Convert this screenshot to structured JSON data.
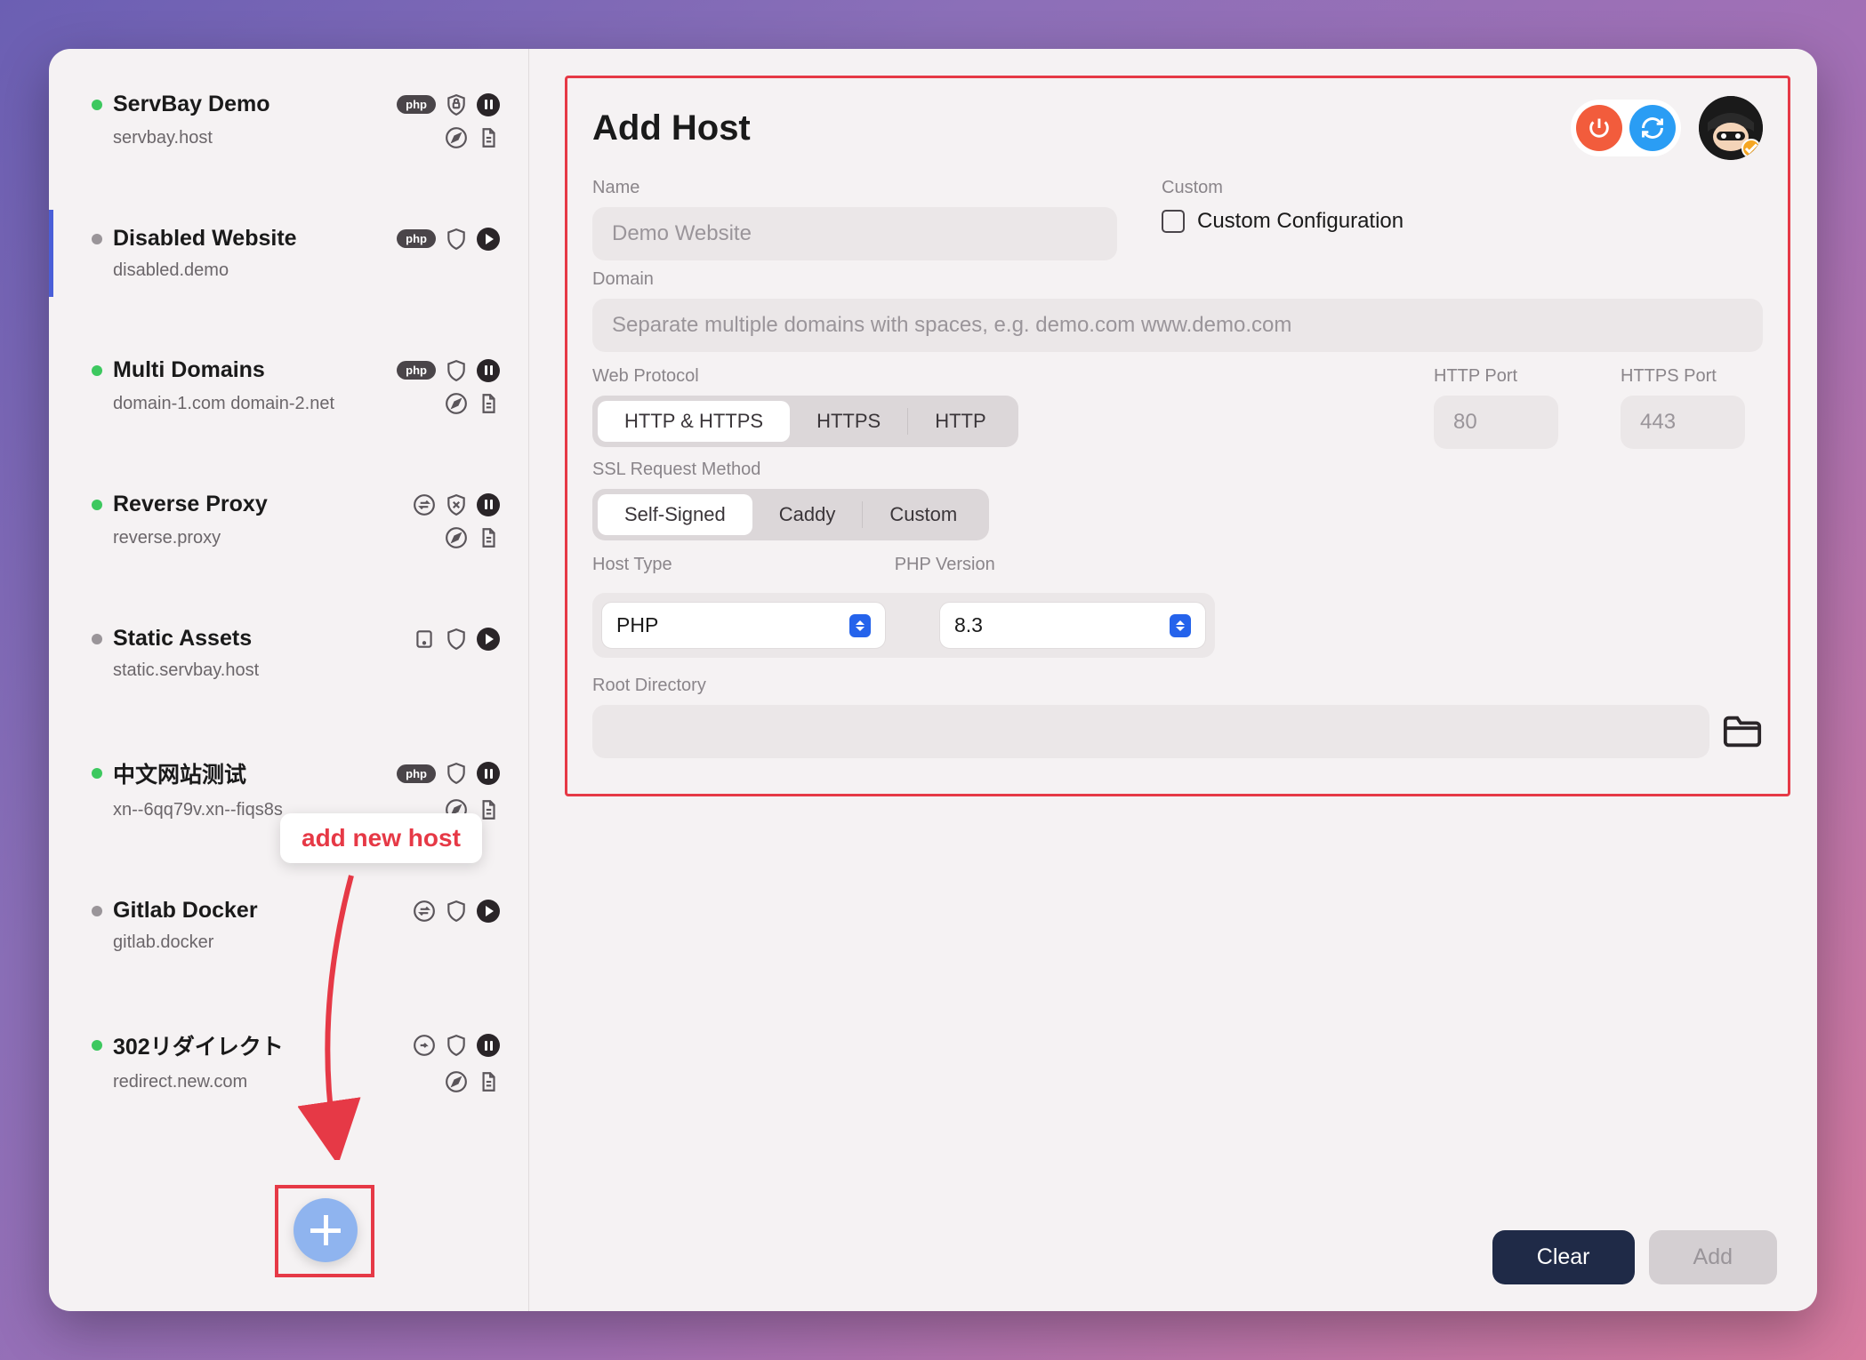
{
  "sidebar": {
    "hosts": [
      {
        "name": "ServBay Demo",
        "domain": "servbay.host",
        "status": "green",
        "badge": "php",
        "icons_top": [
          "shield-lock",
          "pause"
        ],
        "icons_sub": [
          "compass",
          "doc"
        ]
      },
      {
        "name": "Disabled Website",
        "domain": "disabled.demo",
        "status": "grey",
        "badge": "php",
        "icons_top": [
          "shield",
          "play"
        ],
        "icons_sub": [],
        "selected": true
      },
      {
        "name": "Multi Domains",
        "domain": "domain-1.com domain-2.net",
        "status": "green",
        "badge": "php",
        "icons_top": [
          "shield",
          "pause"
        ],
        "icons_sub": [
          "compass",
          "doc"
        ]
      },
      {
        "name": "Reverse Proxy",
        "domain": "reverse.proxy",
        "status": "green",
        "badge": "swap",
        "icons_top": [
          "shield-x",
          "pause"
        ],
        "icons_sub": [
          "compass",
          "doc"
        ]
      },
      {
        "name": "Static Assets",
        "domain": "static.servbay.host",
        "status": "grey",
        "badge": "box",
        "icons_top": [
          "shield",
          "play"
        ],
        "icons_sub": []
      },
      {
        "name": "中文网站测试",
        "domain": "xn--6qq79v.xn--fiqs8s",
        "status": "green",
        "badge": "php",
        "icons_top": [
          "shield",
          "pause"
        ],
        "icons_sub": [
          "compass",
          "doc"
        ]
      },
      {
        "name": "Gitlab Docker",
        "domain": "gitlab.docker",
        "status": "grey",
        "badge": "swap",
        "icons_top": [
          "shield",
          "play"
        ],
        "icons_sub": []
      },
      {
        "name": "302リダイレクト",
        "domain": "redirect.new.com",
        "status": "green",
        "badge": "redirect",
        "icons_top": [
          "shield",
          "pause"
        ],
        "icons_sub": [
          "compass",
          "doc"
        ]
      }
    ]
  },
  "annotation": {
    "tooltip": "add new host"
  },
  "main": {
    "title": "Add Host",
    "labels": {
      "name": "Name",
      "domain": "Domain",
      "protocol": "Web Protocol",
      "http_port": "HTTP Port",
      "https_port": "HTTPS Port",
      "ssl": "SSL Request Method",
      "host_type": "Host Type",
      "php_version": "PHP Version",
      "root": "Root Directory",
      "custom": "Custom",
      "custom_config": "Custom Configuration"
    },
    "placeholders": {
      "name": "Demo Website",
      "domain": "Separate multiple domains with spaces, e.g. demo.com www.demo.com",
      "http_port": "80",
      "https_port": "443"
    },
    "protocol_options": [
      "HTTP & HTTPS",
      "HTTPS",
      "HTTP"
    ],
    "protocol_selected": "HTTP & HTTPS",
    "ssl_options": [
      "Self-Signed",
      "Caddy",
      "Custom"
    ],
    "ssl_selected": "Self-Signed",
    "host_type_value": "PHP",
    "php_version_value": "8.3"
  },
  "footer": {
    "clear": "Clear",
    "add": "Add"
  }
}
